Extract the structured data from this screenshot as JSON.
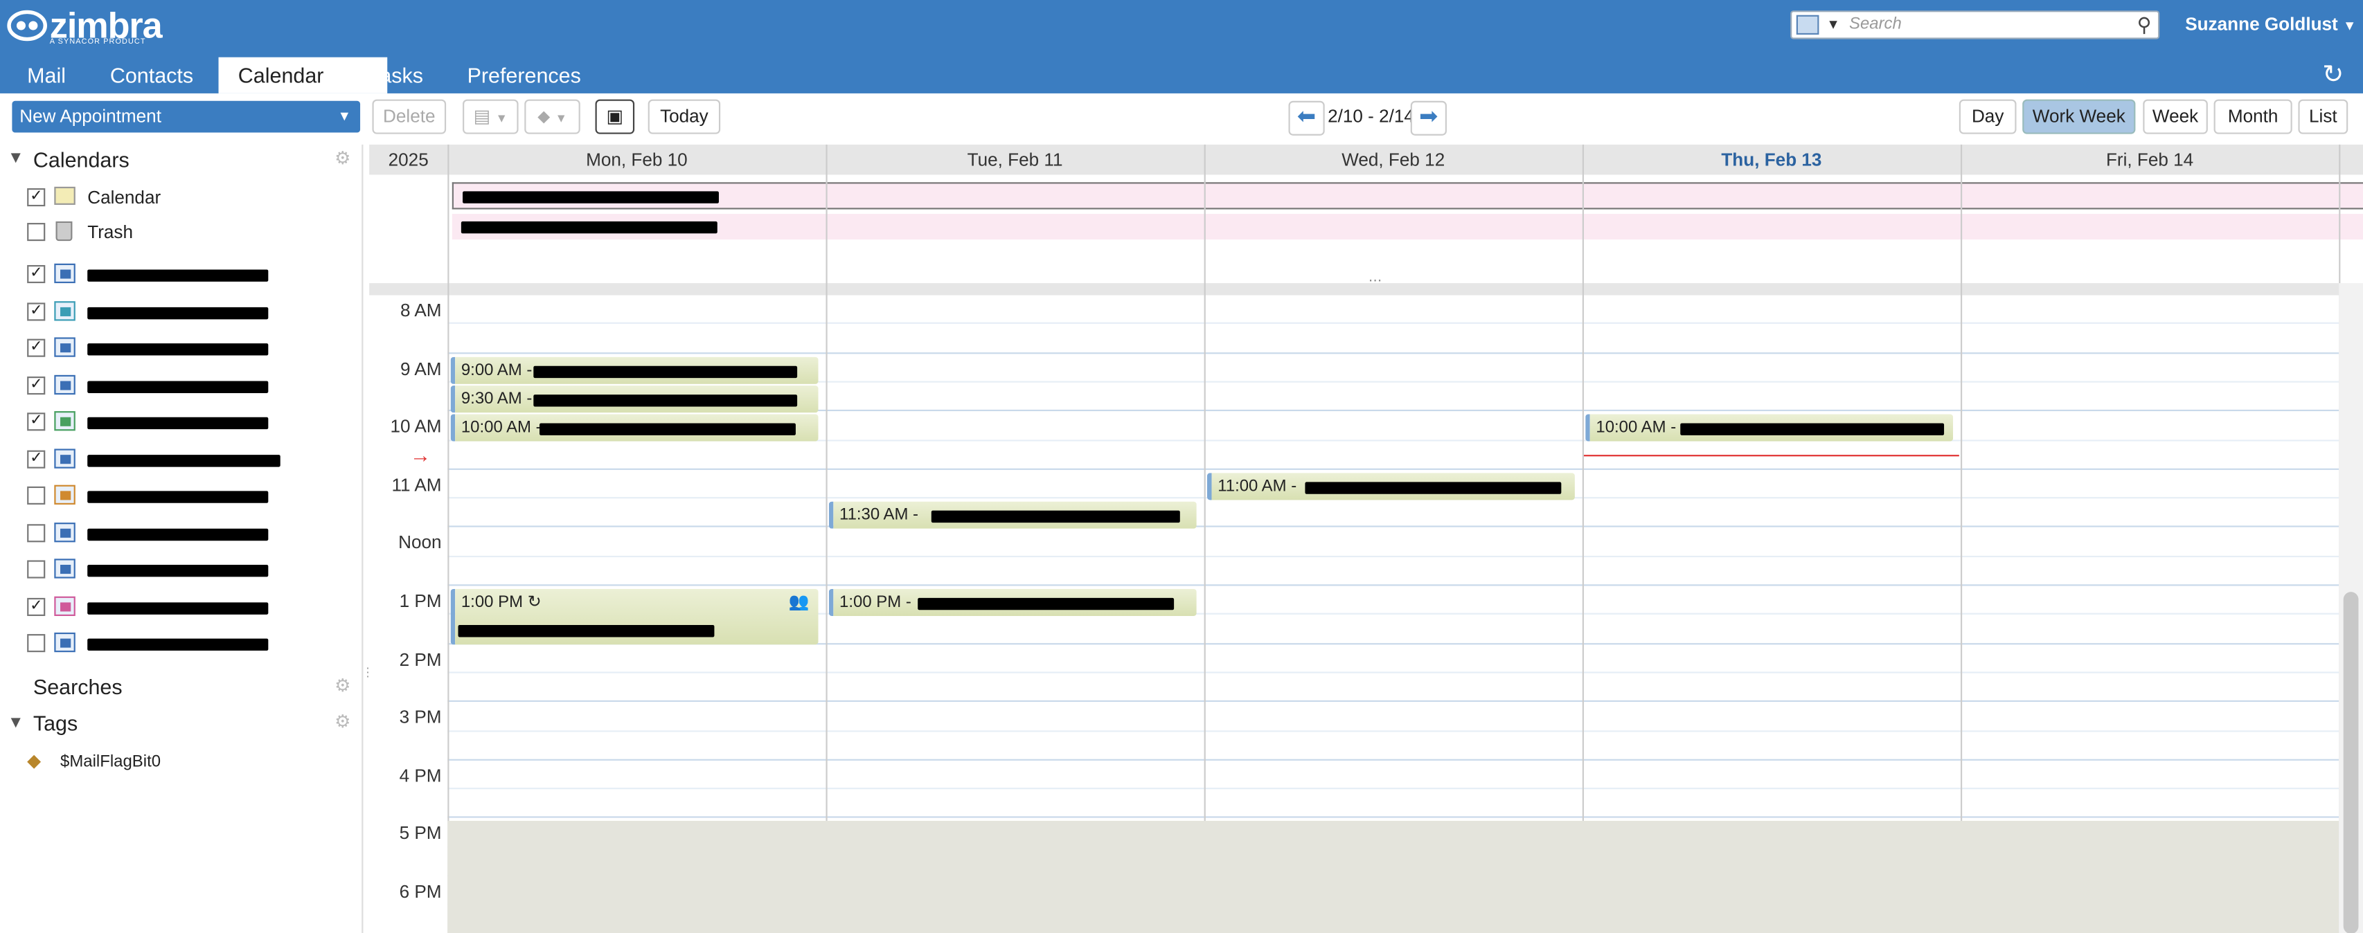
{
  "app": {
    "logo": "zimbra",
    "logo_sub": "A SYNACOR PRODUCT"
  },
  "search": {
    "placeholder": "Search"
  },
  "user": {
    "name": "Suzanne Goldlust"
  },
  "tabs": [
    "Mail",
    "Contacts",
    "Calendar",
    "Tasks",
    "Preferences"
  ],
  "toolbar": {
    "new_appointment": "New Appointment",
    "delete": "Delete",
    "today": "Today",
    "date_range": "2/10 - 2/14",
    "views": [
      "Day",
      "Work Week",
      "Week",
      "Month",
      "List"
    ]
  },
  "sidebar": {
    "calendars_title": "Calendars",
    "searches_title": "Searches",
    "tags_title": "Tags",
    "calendars": [
      {
        "label": "Calendar",
        "checked": true,
        "icon": "calendar-icon"
      },
      {
        "label": "Trash",
        "checked": false,
        "icon": "trash-icon"
      },
      {
        "label": "",
        "checked": true,
        "icon": "shared-calendar-icon"
      },
      {
        "label": "",
        "checked": true,
        "icon": "shared-calendar-icon"
      },
      {
        "label": "",
        "checked": true,
        "icon": "shared-calendar-icon"
      },
      {
        "label": "",
        "checked": true,
        "icon": "shared-calendar-icon"
      },
      {
        "label": "",
        "checked": true,
        "icon": "shared-calendar-icon"
      },
      {
        "label": "",
        "checked": true,
        "icon": "shared-calendar-icon"
      },
      {
        "label": "",
        "checked": false,
        "icon": "shared-calendar-icon"
      },
      {
        "label": "",
        "checked": false,
        "icon": "shared-calendar-icon"
      },
      {
        "label": "",
        "checked": false,
        "icon": "shared-calendar-icon"
      },
      {
        "label": "",
        "checked": true,
        "icon": "shared-calendar-icon"
      },
      {
        "label": "",
        "checked": false,
        "icon": "shared-calendar-icon"
      }
    ],
    "tags": [
      "$MailFlagBit0"
    ]
  },
  "grid": {
    "year": "2025",
    "days": [
      "Mon, Feb 10",
      "Tue, Feb 11",
      "Wed, Feb 12",
      "Thu, Feb 13",
      "Fri, Feb 14"
    ],
    "today": "Thu, Feb 13",
    "hours": [
      "8 AM",
      "9 AM",
      "10 AM",
      "11 AM",
      "Noon",
      "1 PM",
      "2 PM",
      "3 PM",
      "4 PM",
      "5 PM",
      "6 PM"
    ]
  },
  "appointments": [
    {
      "day": 0,
      "start": "9:00 AM",
      "label": "9:00 AM - "
    },
    {
      "day": 0,
      "start": "9:30 AM",
      "label": "9:30 AM - "
    },
    {
      "day": 0,
      "start": "10:00 AM",
      "label": "10:00 AM - "
    },
    {
      "day": 0,
      "start": "1:00 PM",
      "label": "1:00 PM"
    },
    {
      "day": 1,
      "start": "11:30 AM",
      "label": "11:30 AM - "
    },
    {
      "day": 1,
      "start": "1:00 PM",
      "label": "1:00 PM - "
    },
    {
      "day": 2,
      "start": "11:00 AM",
      "label": "11:00 AM - "
    },
    {
      "day": 3,
      "start": "10:00 AM",
      "label": "10:00 AM - "
    }
  ],
  "colors": {
    "header": "#3b7dc1",
    "today_text": "#2b62a0",
    "now_line": "#e03030"
  }
}
